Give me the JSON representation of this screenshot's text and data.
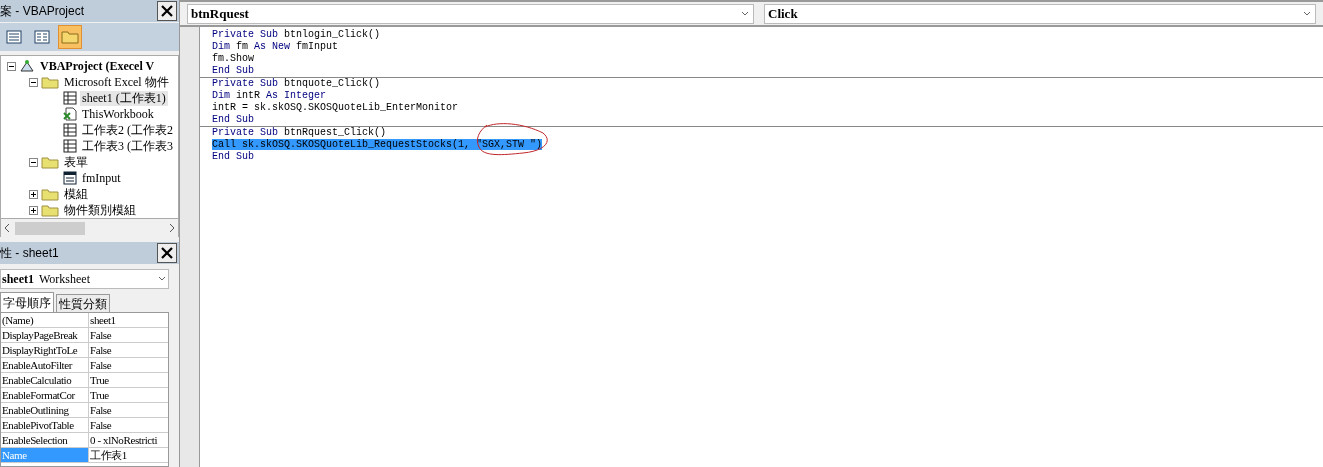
{
  "project_panel": {
    "title": "案 - VBAProject",
    "toolbar": [
      {
        "kind": "object",
        "selected": false
      },
      {
        "kind": "code",
        "selected": false
      },
      {
        "kind": "folder",
        "selected": true
      }
    ],
    "tree": [
      {
        "label": "VBAProject (Execel V",
        "kind": "project",
        "expanded": true,
        "selected": false,
        "children": [
          {
            "label": "Microsoft Excel 物件",
            "kind": "folder",
            "expanded": true,
            "selected": false,
            "children": [
              {
                "label": "sheet1 (工作表1)",
                "kind": "sheet",
                "selected": true
              },
              {
                "label": "ThisWorkbook",
                "kind": "workbook",
                "selected": false
              },
              {
                "label": "工作表2 (工作表2",
                "kind": "sheet",
                "selected": false
              },
              {
                "label": "工作表3 (工作表3",
                "kind": "sheet",
                "selected": false
              }
            ]
          },
          {
            "label": "表單",
            "kind": "folder",
            "expanded": true,
            "selected": false,
            "children": [
              {
                "label": "fmInput",
                "kind": "form",
                "selected": false
              }
            ]
          },
          {
            "label": "模組",
            "kind": "folder",
            "expanded": false,
            "selected": false
          },
          {
            "label": "物件類別模組",
            "kind": "folder",
            "expanded": false,
            "selected": false
          }
        ]
      }
    ]
  },
  "properties_panel": {
    "title": "性 - sheet1",
    "object": {
      "name": "sheet1",
      "type": "Worksheet"
    },
    "tabs": [
      {
        "label": "字母順序",
        "selected": true
      },
      {
        "label": "性質分類",
        "selected": false
      }
    ],
    "rows": [
      {
        "name": "(Name)",
        "value": "sheet1",
        "selected": false
      },
      {
        "name": "DisplayPageBreak",
        "value": "False",
        "selected": false
      },
      {
        "name": "DisplayRightToLe",
        "value": "False",
        "selected": false
      },
      {
        "name": "EnableAutoFilter",
        "value": "False",
        "selected": false
      },
      {
        "name": "EnableCalculatio",
        "value": "True",
        "selected": false
      },
      {
        "name": "EnableFormatCor",
        "value": "True",
        "selected": false
      },
      {
        "name": "EnableOutlining",
        "value": "False",
        "selected": false
      },
      {
        "name": "EnablePivotTable",
        "value": "False",
        "selected": false
      },
      {
        "name": "EnableSelection",
        "value": "0 - xlNoRestricti",
        "selected": false
      },
      {
        "name": "Name",
        "value": "工作表1",
        "selected": true
      }
    ]
  },
  "code_window": {
    "object_combo": "btnRquest",
    "procedure_combo": "Click",
    "procedures": [
      {
        "lines": [
          {
            "highlighted": false,
            "tokens": [
              {
                "kind": "keyword",
                "text": "Private Sub"
              },
              {
                "kind": "plain",
                "text": " btnlogin_Click()"
              }
            ]
          },
          {
            "highlighted": false,
            "tokens": [
              {
                "kind": "keyword",
                "text": "Dim"
              },
              {
                "kind": "plain",
                "text": " fm "
              },
              {
                "kind": "keyword",
                "text": "As New"
              },
              {
                "kind": "plain",
                "text": " fmInput"
              }
            ]
          },
          {
            "highlighted": false,
            "tokens": [
              {
                "kind": "plain",
                "text": "fm.Show"
              }
            ]
          },
          {
            "highlighted": false,
            "tokens": [
              {
                "kind": "keyword",
                "text": "End Sub"
              }
            ]
          }
        ]
      },
      {
        "lines": [
          {
            "highlighted": false,
            "tokens": [
              {
                "kind": "keyword",
                "text": "Private Sub"
              },
              {
                "kind": "plain",
                "text": " btnquote_Click()"
              }
            ]
          },
          {
            "highlighted": false,
            "tokens": [
              {
                "kind": "keyword",
                "text": "Dim"
              },
              {
                "kind": "plain",
                "text": " intR "
              },
              {
                "kind": "keyword",
                "text": "As Integer"
              }
            ]
          },
          {
            "highlighted": false,
            "tokens": [
              {
                "kind": "plain",
                "text": "intR = sk.skOSQ.SKOSQuoteLib_EnterMonitor"
              }
            ]
          },
          {
            "highlighted": false,
            "tokens": [
              {
                "kind": "keyword",
                "text": "End Sub"
              }
            ]
          }
        ]
      },
      {
        "lines": [
          {
            "highlighted": false,
            "tokens": [
              {
                "kind": "keyword",
                "text": "Private Sub"
              },
              {
                "kind": "plain",
                "text": " btnRquest_Click()"
              }
            ]
          },
          {
            "highlighted": true,
            "text": "Call sk.skOSQ.SKOSQuoteLib_RequestStocks(1, \"SGX,STW \")"
          },
          {
            "highlighted": false,
            "tokens": [
              {
                "kind": "keyword",
                "text": "End Sub"
              }
            ]
          }
        ]
      }
    ]
  }
}
